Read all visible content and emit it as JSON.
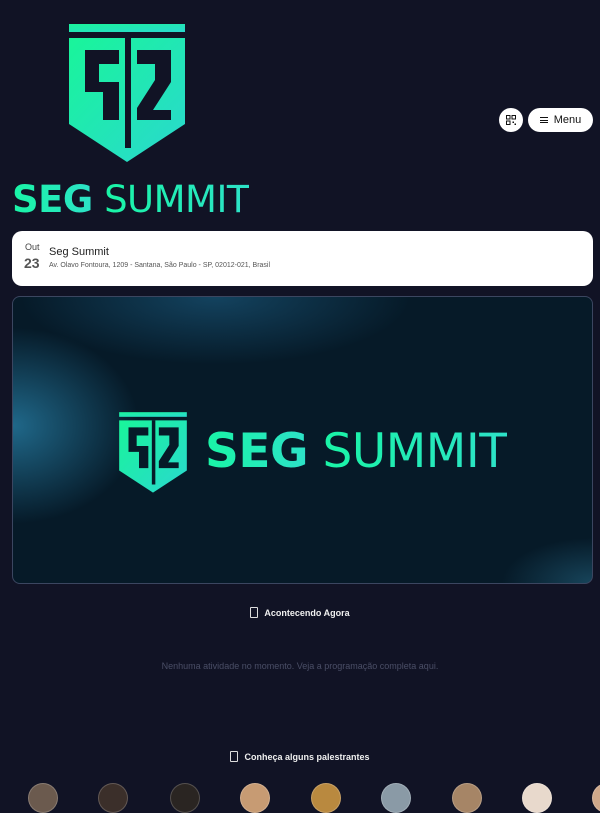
{
  "brand": {
    "name_bold": "SEG",
    "name_light": "SUMMIT",
    "logo_icon": "shield-logo-icon",
    "accent_color": "#19f5a6"
  },
  "header": {
    "qr_icon": "qr-code-icon",
    "menu_label": "Menu",
    "menu_icon": "hamburger-icon"
  },
  "event": {
    "month": "Out",
    "day": "23",
    "name": "Seg Summit",
    "address": "Av. Olavo Fontoura, 1209 - Santana, São Paulo - SP, 02012-021, Brasil"
  },
  "banner": {
    "title_bold": "SEG",
    "title_light": "SUMMIT"
  },
  "now": {
    "heading": "Acontecendo Agora",
    "empty_message": "Nenhuma atividade no momento. Veja a programação completa aqui."
  },
  "speakers": {
    "heading": "Conheça alguns palestrantes",
    "count_visible": 8
  }
}
